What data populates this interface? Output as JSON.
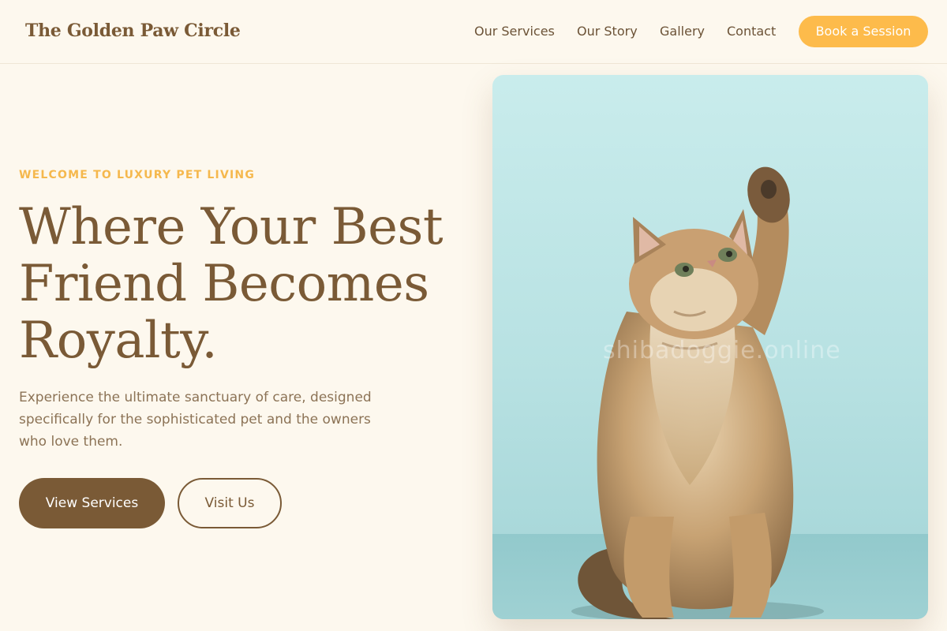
{
  "header": {
    "brand": "The Golden Paw Circle",
    "nav": [
      {
        "label": "Our Services"
      },
      {
        "label": "Our Story"
      },
      {
        "label": "Gallery"
      },
      {
        "label": "Contact"
      }
    ],
    "cta": "Book a Session"
  },
  "hero": {
    "eyebrow": "WELCOME TO LUXURY PET LIVING",
    "headline_lines": [
      "Where Your Best",
      "Friend Becomes",
      "Royalty."
    ],
    "lede": "Experience the ultimate sanctuary of care, designed specifically for the sophisticated pet and the owners who love them.",
    "primary_button": "View Services",
    "secondary_button": "Visit Us"
  },
  "photo": {
    "watermark": "shibadoggie.online"
  },
  "colors": {
    "background": "#fdf8ee",
    "brand_brown": "#7a5a36",
    "accent_gold": "#fdbb4b",
    "photo_backdrop": "#c9ecec"
  }
}
